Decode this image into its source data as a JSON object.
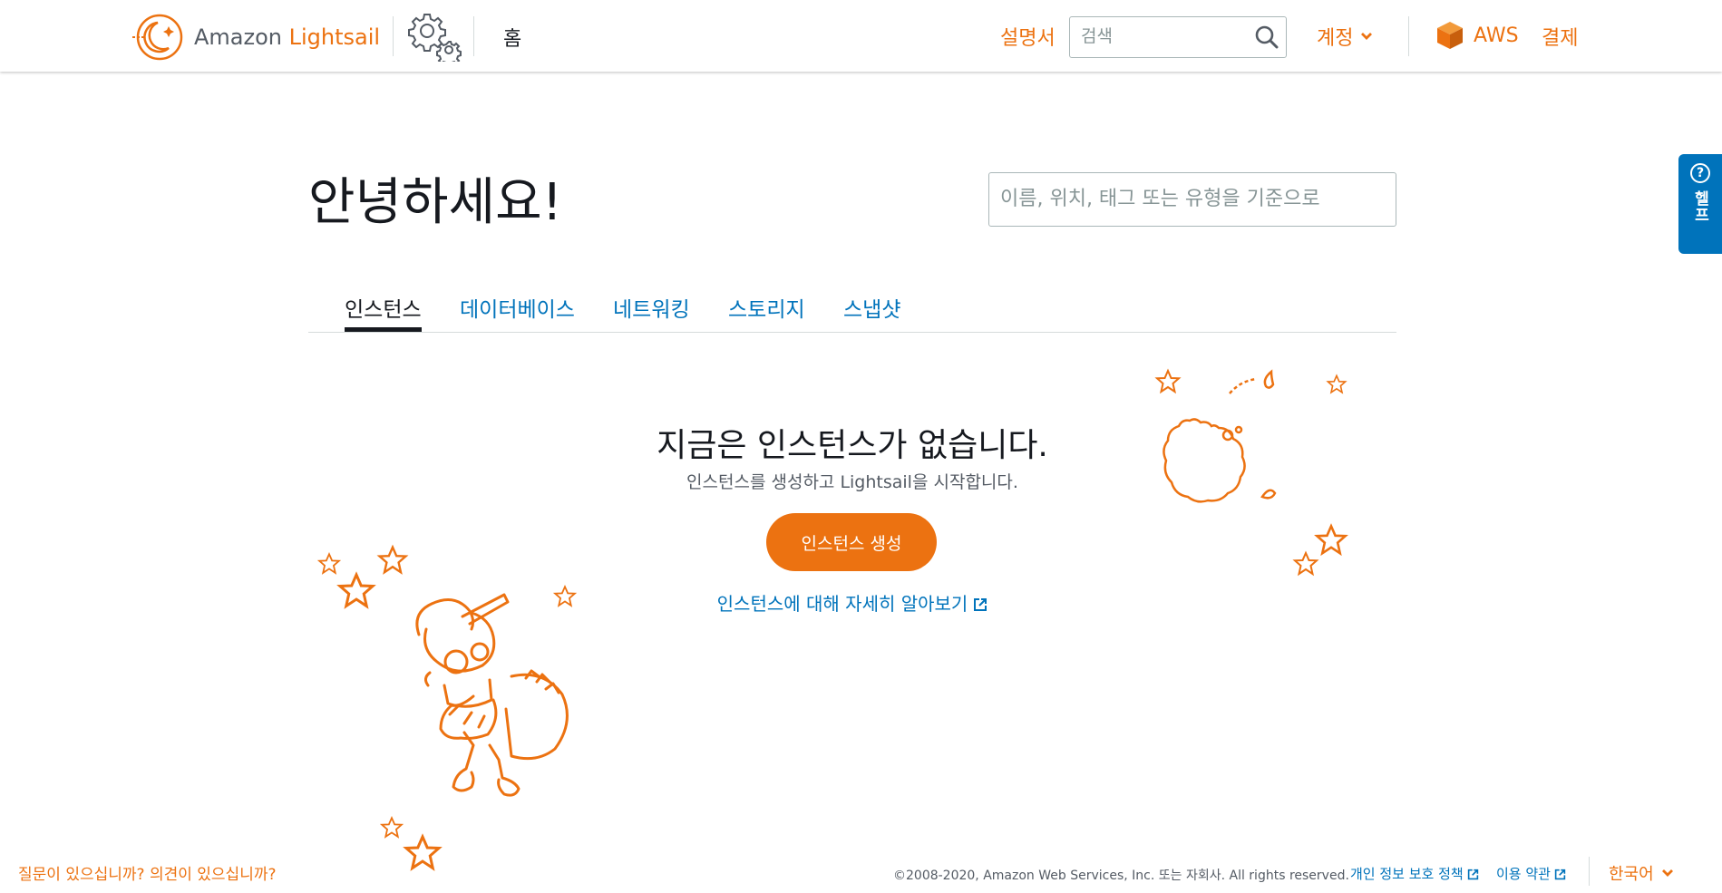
{
  "header": {
    "logo_prefix": "Amazon",
    "logo_brand": "Lightsail",
    "home_label": "홈",
    "docs_label": "설명서",
    "search_placeholder": "검색",
    "account_label": "계정",
    "aws_label": "AWS",
    "billing_label": "결제"
  },
  "help_tab": {
    "icon": "?",
    "label": "헬프"
  },
  "main": {
    "greeting": "안녕하세요!",
    "filter_placeholder": "이름, 위치, 태그 또는 유형을 기준으로",
    "tabs": [
      {
        "label": "인스턴스",
        "active": true
      },
      {
        "label": "데이터베이스",
        "active": false
      },
      {
        "label": "네트워킹",
        "active": false
      },
      {
        "label": "스토리지",
        "active": false
      },
      {
        "label": "스냅샷",
        "active": false
      }
    ],
    "empty_title": "지금은 인스턴스가 없습니다.",
    "empty_subtitle": "인스턴스를 생성하고 Lightsail을 시작합니다.",
    "create_button": "인스턴스 생성",
    "learn_more": "인스턴스에 대해 자세히 알아보기"
  },
  "footer": {
    "feedback": "질문이 있으십니까? 의견이 있으십니까?",
    "copyright": "©2008-2020, Amazon Web Services, Inc. 또는 자회사. All rights reserved.",
    "privacy": "개인 정보 보호 정책",
    "terms": "이용 약관",
    "language": "한국어"
  },
  "colors": {
    "accent": "#ec7211",
    "link": "#0073bb",
    "text": "#16191f"
  },
  "icons": [
    "lightsail-logo-icon",
    "gear-icon",
    "search-icon",
    "chevron-down-icon",
    "aws-cube-icon",
    "help-icon",
    "external-link-icon",
    "robot-illustration",
    "planet-illustration",
    "star-icon"
  ]
}
